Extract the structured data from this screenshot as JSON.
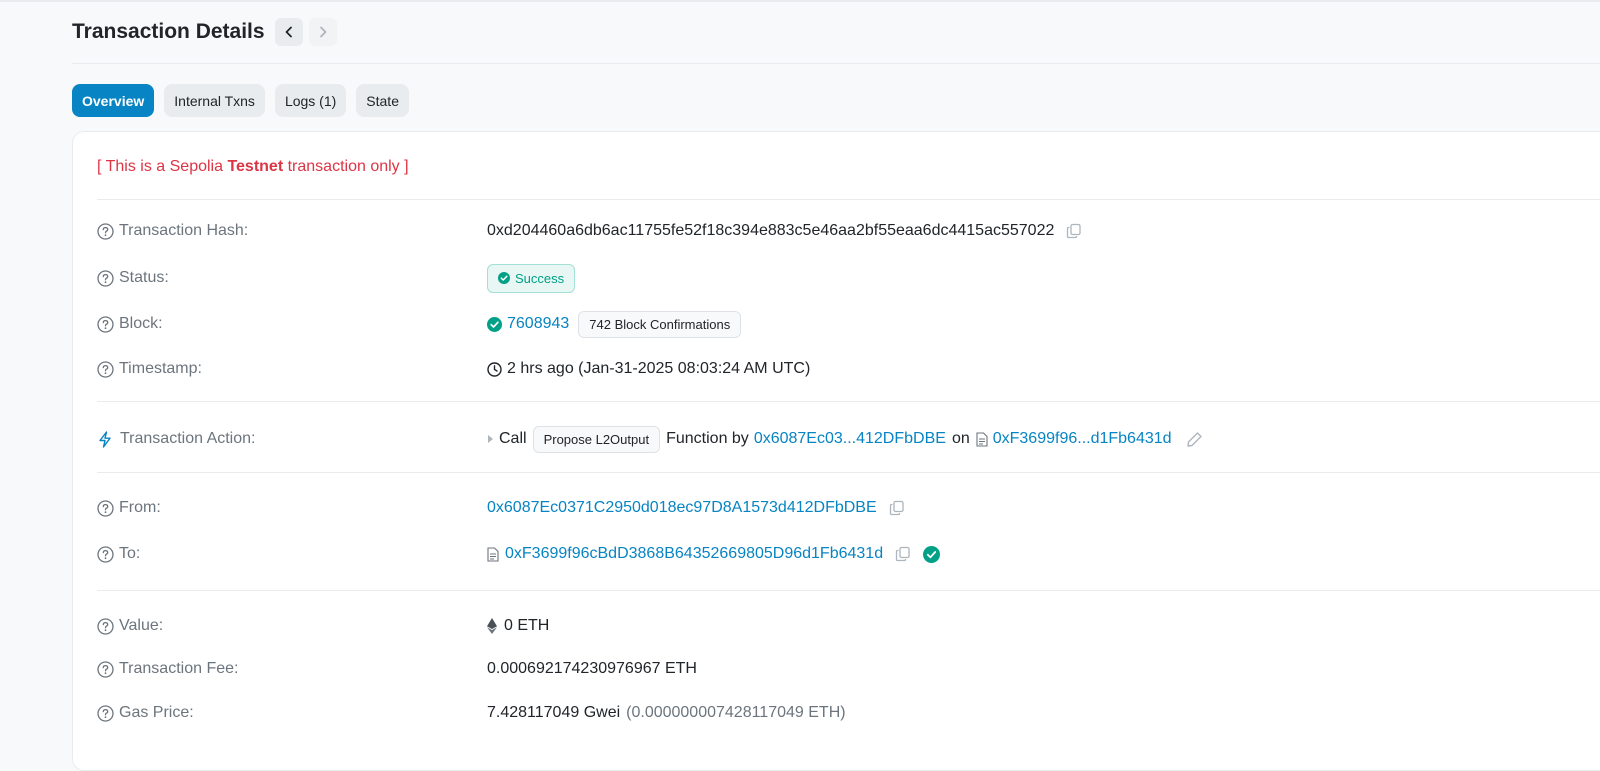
{
  "header": {
    "title": "Transaction Details"
  },
  "tabs": [
    {
      "label": "Overview"
    },
    {
      "label": "Internal Txns"
    },
    {
      "label": "Logs (1)"
    },
    {
      "label": "State"
    }
  ],
  "notice": {
    "prefix": "[ This is a Sepolia ",
    "emphasis": "Testnet",
    "suffix": " transaction only ]"
  },
  "fields": {
    "hash": {
      "label": "Transaction Hash:",
      "value": "0xd204460a6db6ac11755fe52f18c394e883c5e46aa2bf55eaa6dc4415ac557022"
    },
    "status": {
      "label": "Status:",
      "value": "Success"
    },
    "block": {
      "label": "Block:",
      "number": "7608943",
      "confirmations": "742 Block Confirmations"
    },
    "timestamp": {
      "label": "Timestamp:",
      "value": "2 hrs ago (Jan-31-2025 08:03:24 AM UTC)"
    },
    "action": {
      "label": "Transaction Action:",
      "call": "Call",
      "method": "Propose L2Output",
      "function_by": "Function by",
      "by_address": "0x6087Ec03...412DFbDBE",
      "on": "on",
      "contract": "0xF3699f96...d1Fb6431d"
    },
    "from": {
      "label": "From:",
      "value": "0x6087Ec0371C2950d018ec97D8A1573d412DFbDBE"
    },
    "to": {
      "label": "To:",
      "value": "0xF3699f96cBdD3868B64352669805D96d1Fb6431d"
    },
    "value": {
      "label": "Value:",
      "value": "0 ETH"
    },
    "fee": {
      "label": "Transaction Fee:",
      "value": "0.000692174230976967 ETH"
    },
    "gas_price": {
      "label": "Gas Price:",
      "gwei": "7.428117049 Gwei",
      "eth": "(0.000000007428117049 ETH)"
    }
  },
  "colors": {
    "accent": "#0784c3",
    "success": "#00a186",
    "danger": "#dc3545"
  }
}
